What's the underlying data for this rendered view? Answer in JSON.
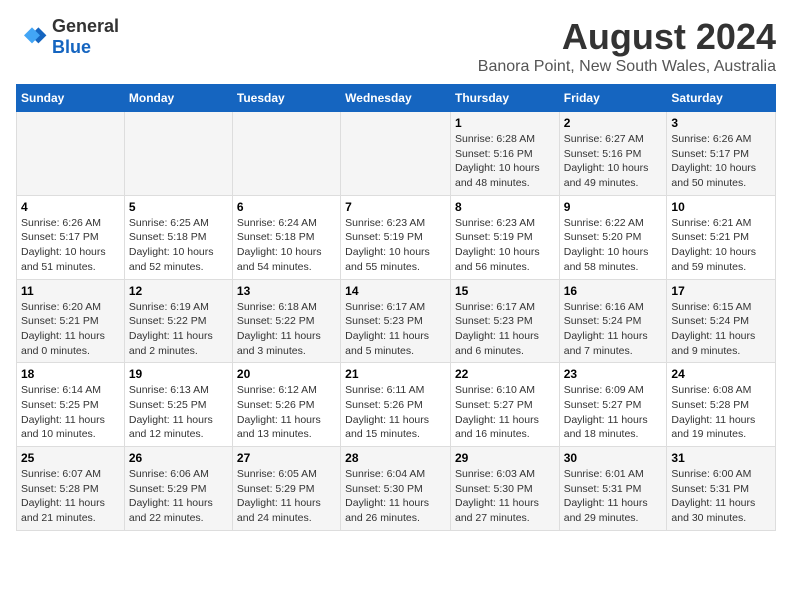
{
  "logo": {
    "text_general": "General",
    "text_blue": "Blue"
  },
  "title": {
    "month_year": "August 2024",
    "location": "Banora Point, New South Wales, Australia"
  },
  "days_of_week": [
    "Sunday",
    "Monday",
    "Tuesday",
    "Wednesday",
    "Thursday",
    "Friday",
    "Saturday"
  ],
  "weeks": [
    [
      {
        "day": "",
        "content": ""
      },
      {
        "day": "",
        "content": ""
      },
      {
        "day": "",
        "content": ""
      },
      {
        "day": "",
        "content": ""
      },
      {
        "day": "1",
        "content": "Sunrise: 6:28 AM\nSunset: 5:16 PM\nDaylight: 10 hours and 48 minutes."
      },
      {
        "day": "2",
        "content": "Sunrise: 6:27 AM\nSunset: 5:16 PM\nDaylight: 10 hours and 49 minutes."
      },
      {
        "day": "3",
        "content": "Sunrise: 6:26 AM\nSunset: 5:17 PM\nDaylight: 10 hours and 50 minutes."
      }
    ],
    [
      {
        "day": "4",
        "content": "Sunrise: 6:26 AM\nSunset: 5:17 PM\nDaylight: 10 hours and 51 minutes."
      },
      {
        "day": "5",
        "content": "Sunrise: 6:25 AM\nSunset: 5:18 PM\nDaylight: 10 hours and 52 minutes."
      },
      {
        "day": "6",
        "content": "Sunrise: 6:24 AM\nSunset: 5:18 PM\nDaylight: 10 hours and 54 minutes."
      },
      {
        "day": "7",
        "content": "Sunrise: 6:23 AM\nSunset: 5:19 PM\nDaylight: 10 hours and 55 minutes."
      },
      {
        "day": "8",
        "content": "Sunrise: 6:23 AM\nSunset: 5:19 PM\nDaylight: 10 hours and 56 minutes."
      },
      {
        "day": "9",
        "content": "Sunrise: 6:22 AM\nSunset: 5:20 PM\nDaylight: 10 hours and 58 minutes."
      },
      {
        "day": "10",
        "content": "Sunrise: 6:21 AM\nSunset: 5:21 PM\nDaylight: 10 hours and 59 minutes."
      }
    ],
    [
      {
        "day": "11",
        "content": "Sunrise: 6:20 AM\nSunset: 5:21 PM\nDaylight: 11 hours and 0 minutes."
      },
      {
        "day": "12",
        "content": "Sunrise: 6:19 AM\nSunset: 5:22 PM\nDaylight: 11 hours and 2 minutes."
      },
      {
        "day": "13",
        "content": "Sunrise: 6:18 AM\nSunset: 5:22 PM\nDaylight: 11 hours and 3 minutes."
      },
      {
        "day": "14",
        "content": "Sunrise: 6:17 AM\nSunset: 5:23 PM\nDaylight: 11 hours and 5 minutes."
      },
      {
        "day": "15",
        "content": "Sunrise: 6:17 AM\nSunset: 5:23 PM\nDaylight: 11 hours and 6 minutes."
      },
      {
        "day": "16",
        "content": "Sunrise: 6:16 AM\nSunset: 5:24 PM\nDaylight: 11 hours and 7 minutes."
      },
      {
        "day": "17",
        "content": "Sunrise: 6:15 AM\nSunset: 5:24 PM\nDaylight: 11 hours and 9 minutes."
      }
    ],
    [
      {
        "day": "18",
        "content": "Sunrise: 6:14 AM\nSunset: 5:25 PM\nDaylight: 11 hours and 10 minutes."
      },
      {
        "day": "19",
        "content": "Sunrise: 6:13 AM\nSunset: 5:25 PM\nDaylight: 11 hours and 12 minutes."
      },
      {
        "day": "20",
        "content": "Sunrise: 6:12 AM\nSunset: 5:26 PM\nDaylight: 11 hours and 13 minutes."
      },
      {
        "day": "21",
        "content": "Sunrise: 6:11 AM\nSunset: 5:26 PM\nDaylight: 11 hours and 15 minutes."
      },
      {
        "day": "22",
        "content": "Sunrise: 6:10 AM\nSunset: 5:27 PM\nDaylight: 11 hours and 16 minutes."
      },
      {
        "day": "23",
        "content": "Sunrise: 6:09 AM\nSunset: 5:27 PM\nDaylight: 11 hours and 18 minutes."
      },
      {
        "day": "24",
        "content": "Sunrise: 6:08 AM\nSunset: 5:28 PM\nDaylight: 11 hours and 19 minutes."
      }
    ],
    [
      {
        "day": "25",
        "content": "Sunrise: 6:07 AM\nSunset: 5:28 PM\nDaylight: 11 hours and 21 minutes."
      },
      {
        "day": "26",
        "content": "Sunrise: 6:06 AM\nSunset: 5:29 PM\nDaylight: 11 hours and 22 minutes."
      },
      {
        "day": "27",
        "content": "Sunrise: 6:05 AM\nSunset: 5:29 PM\nDaylight: 11 hours and 24 minutes."
      },
      {
        "day": "28",
        "content": "Sunrise: 6:04 AM\nSunset: 5:30 PM\nDaylight: 11 hours and 26 minutes."
      },
      {
        "day": "29",
        "content": "Sunrise: 6:03 AM\nSunset: 5:30 PM\nDaylight: 11 hours and 27 minutes."
      },
      {
        "day": "30",
        "content": "Sunrise: 6:01 AM\nSunset: 5:31 PM\nDaylight: 11 hours and 29 minutes."
      },
      {
        "day": "31",
        "content": "Sunrise: 6:00 AM\nSunset: 5:31 PM\nDaylight: 11 hours and 30 minutes."
      }
    ]
  ]
}
